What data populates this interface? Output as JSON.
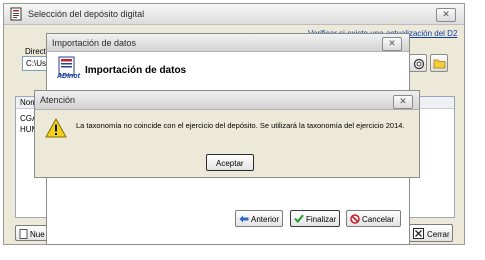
{
  "seleccion_window": {
    "title": "Selección del depósito digital",
    "close_glyph": "✕",
    "verify_link": "Verificar si existe una actualización del D2",
    "directory_label": "Directo",
    "directory_value": "C:\\Use",
    "table_header": "Nom",
    "rows": [
      "CGA",
      "HUM"
    ],
    "new_button": "Nue",
    "close_button": "Cerrar"
  },
  "import_window": {
    "title": "Importación de datos",
    "close_glyph": "✕",
    "heading": "Importación de datos",
    "logo_text": "ADInot",
    "back_button": "Anterior",
    "finish_button": "Finalizar",
    "cancel_button": "Cancelar"
  },
  "alert_window": {
    "title": "Atención",
    "close_glyph": "✕",
    "message": "La taxonomía no coincide con el ejercicio del depósito. Se utilizará la taxonomía del ejercicio 2014.",
    "accept_button": "Aceptar"
  },
  "icons": [
    "app-document-icon",
    "warning-icon",
    "search-icon",
    "folder-icon",
    "arrow-left-icon",
    "check-icon",
    "cancel-icon",
    "close-x-icon",
    "new-document-icon"
  ],
  "colors": {
    "link": "#0b3fa6",
    "title_text": "#2b2b2b",
    "dialog_bg": "#ece9d8",
    "warning_yellow": "#f2d21a"
  }
}
